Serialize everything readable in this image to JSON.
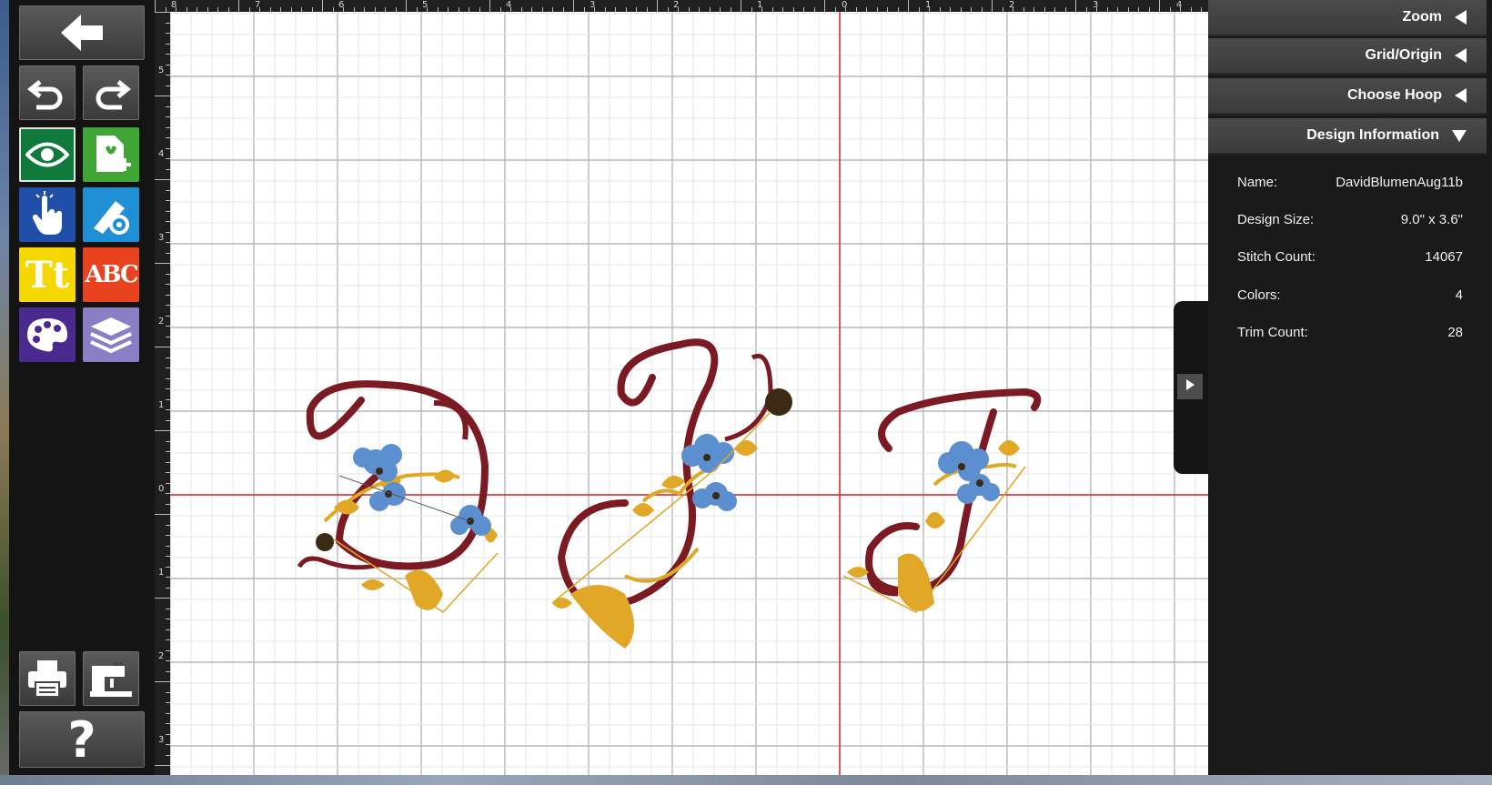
{
  "ruler": {
    "top": [
      "8",
      "7",
      "6",
      "5",
      "4",
      "3",
      "2",
      "1",
      "0",
      "1",
      "2",
      "3",
      "4"
    ],
    "left": [
      "5",
      "4",
      "3",
      "2",
      "1",
      "0",
      "1",
      "2",
      "3"
    ]
  },
  "toolbar": {
    "tools": [
      "back-arrow-icon",
      "undo-icon",
      "redo-icon",
      "view-eye-icon",
      "add-design-icon",
      "touch-select-icon",
      "edit-tools-icon",
      "text-tool-icon",
      "monogram-icon",
      "color-palette-icon",
      "layers-icon",
      "print-icon",
      "send-to-machine-icon",
      "help-icon"
    ],
    "text_tool_label": "Tt",
    "monogram_label": "ABC",
    "help_label": "?"
  },
  "panel": {
    "zoom_label": "Zoom",
    "grid_label": "Grid/Origin",
    "hoop_label": "Choose Hoop",
    "info_label": "Design Information",
    "info": [
      {
        "label": "Name:",
        "value": "DavidBlumenAug11b"
      },
      {
        "label": "Design Size:",
        "value": "9.0\" x 3.6\""
      },
      {
        "label": "Stitch Count:",
        "value": "14067"
      },
      {
        "label": "Colors:",
        "value": "4"
      },
      {
        "label": "Trim Count:",
        "value": "28"
      }
    ]
  },
  "colors": {
    "thread_burgundy": "#7b1a22",
    "thread_gold": "#e0a826",
    "thread_blue": "#5b8fd0",
    "thread_brown": "#3b2a14",
    "origin_line": "#e8262b",
    "grid": "#cfcfcf"
  }
}
